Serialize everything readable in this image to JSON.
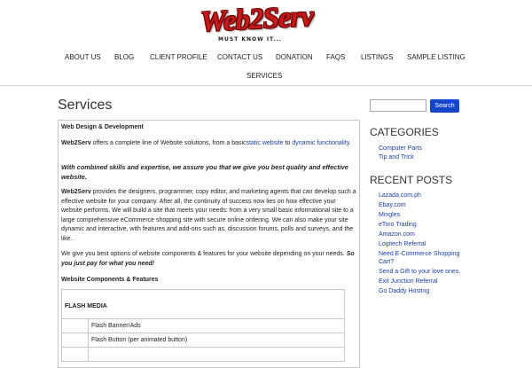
{
  "logo": {
    "text": "Web2Serv",
    "tagline": "MUST KNOW IT..."
  },
  "nav": {
    "items": [
      {
        "label": "ABOUT US"
      },
      {
        "label": "BLOG"
      },
      {
        "label": "CLIENT PROFILE"
      },
      {
        "label": "CONTACT US"
      },
      {
        "label": "DONATION"
      },
      {
        "label": "FAQS"
      },
      {
        "label": "LISTINGS"
      },
      {
        "label": "SAMPLE LISTING"
      },
      {
        "label": "SERVICES"
      }
    ]
  },
  "page": {
    "title": "Services"
  },
  "content": {
    "heading": "Web Design & Development",
    "p1_bold": "Web2Serv",
    "p1_text": " offers a complete line of Website solutions, from a basic",
    "p1_link1": "static website",
    "p1_mid": " to ",
    "p1_link2": "dynamic functionality",
    "p1_end": ".",
    "p2": "With combined skills and expertise, we assure you that we give you best quality and effective website.",
    "p3_bold": "Web2Serv",
    "p3_text": " provides the designers, programmer, copy editor, and marketing agents that can develop such a effective website for your company. After all, the continuity of success now lies on how effective your website performs. We will build a site that meets your needs: from a very small basic informational site to a large comprehensive eCommerce shopping site with secure online ordering. We can also make your site dynamic and interactive, with features and add-ons such as, discussion forums, polls and surveys, and the like.",
    "p4_text": "We give you best options of website components & features for your website depending on your needs. ",
    "p4_emph": "So you just pay for what you need!",
    "components_heading": "Website Components & Features",
    "table": {
      "section": "FLASH MEDIA",
      "rows": [
        "Flash Banner/Ads",
        "Flash Button (per animated button)"
      ]
    }
  },
  "sidebar": {
    "search_button": "Search",
    "categories_heading": "CATEGORIES",
    "categories": [
      "Computer Parts",
      "Tip and Trick"
    ],
    "recent_heading": "RECENT POSTS",
    "recent_posts": [
      "Lazada.com.ph",
      "Ebay.com",
      "Mingles",
      "eToro Trading",
      "Amazon.com",
      "Logitech Referral",
      "Need E-Commerce Shopping",
      "Cart?",
      "Send a Gift to your love ones.",
      "Exit Junction Referral",
      "Go Daddy Hosting"
    ]
  }
}
